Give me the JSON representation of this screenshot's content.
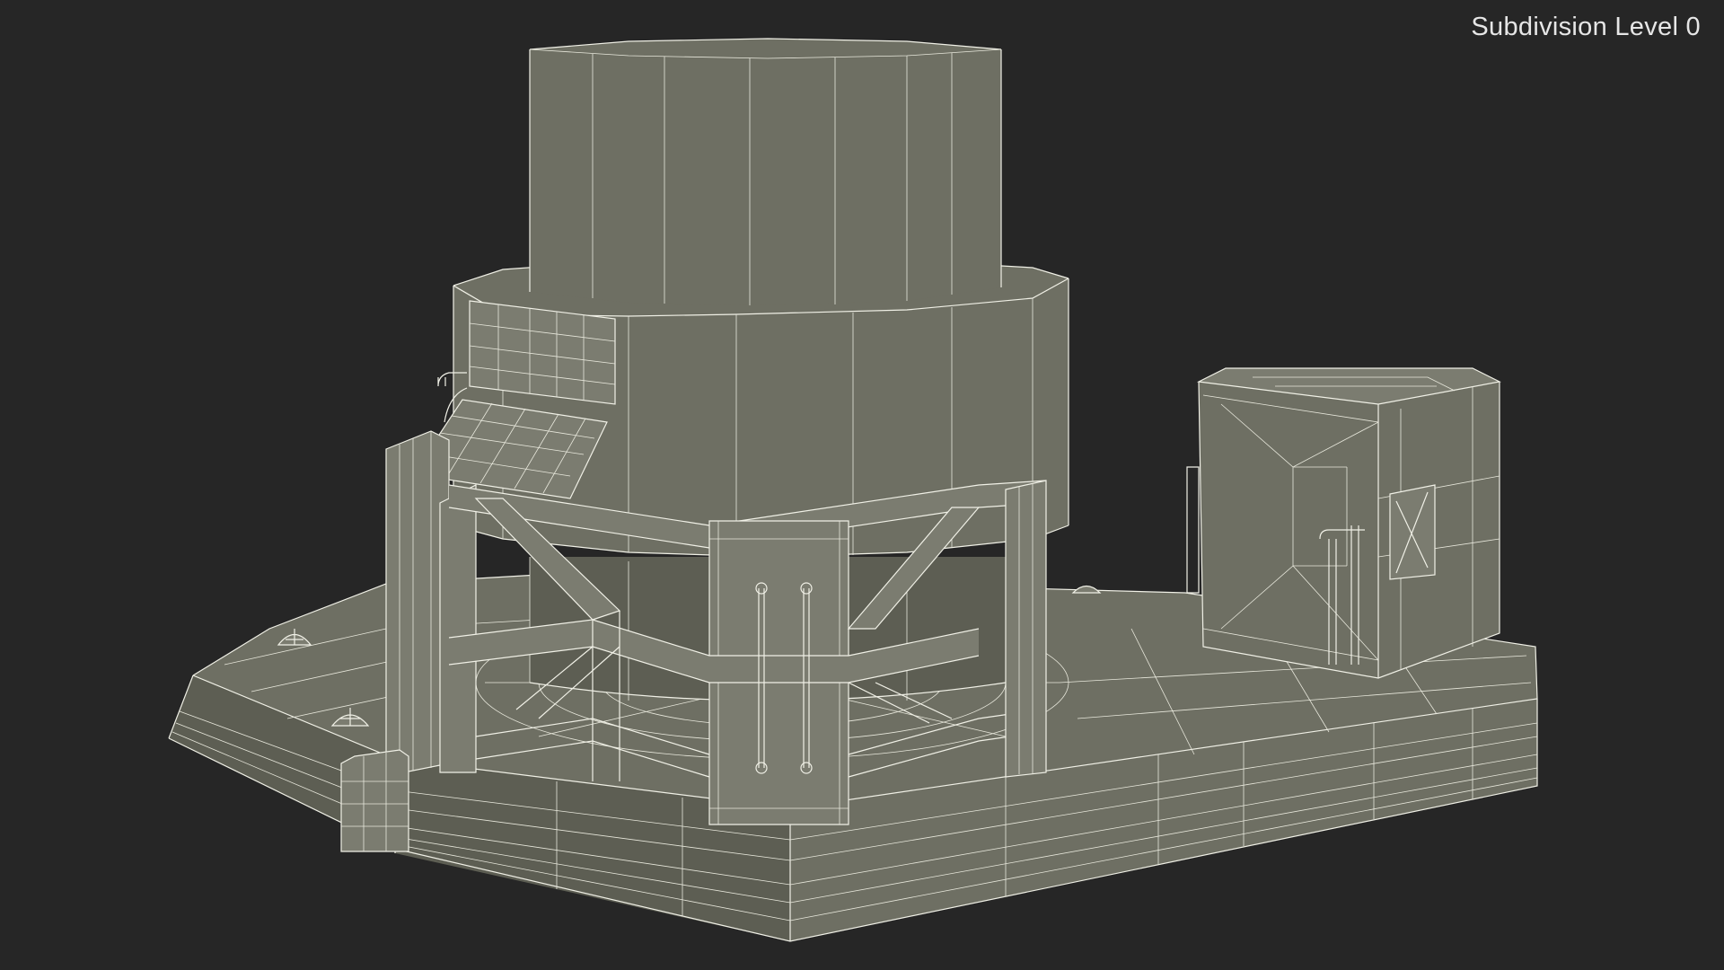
{
  "viewport": {
    "overlay_label": "Subdivision Level 0",
    "background_color": "#262626",
    "model_color": "#6e6f63",
    "wire_color": "#f0f0e6"
  }
}
